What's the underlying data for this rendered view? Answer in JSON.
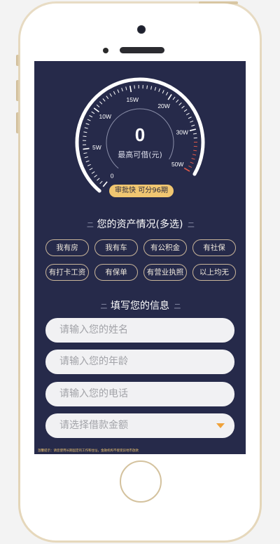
{
  "gauge": {
    "ticks": [
      "0",
      "5W",
      "10W",
      "15W",
      "20W",
      "30W",
      "50W"
    ],
    "value": "0",
    "caption": "最高可借(元)",
    "level": 0
  },
  "approval_badge": "审批快 可分96期",
  "assets": {
    "title": "您的资产情况(多选)",
    "deco": "ニ",
    "options": [
      "我有房",
      "我有车",
      "有公积金",
      "有社保",
      "有打卡工资",
      "有保单",
      "有营业执照",
      "以上均无"
    ]
  },
  "info": {
    "title": "填写您的信息",
    "deco": "ニ",
    "name_placeholder": "请输入您的姓名",
    "age_placeholder": "请输入您的年龄",
    "phone_placeholder": "请输入您的电话",
    "amount_placeholder": "请选择借款金额"
  },
  "footnote": "温馨提示：请您使用长期固定的工作和住址，金融机构不接受异地市放款",
  "colors": {
    "screen_bg": "#262a4a",
    "accent_gold": "#f0c671",
    "chip_border": "#c9b59a",
    "dropdown_caret": "#f0a23a"
  }
}
